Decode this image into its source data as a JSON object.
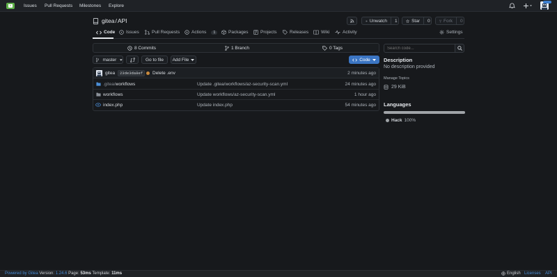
{
  "nav": {
    "items": [
      "Issues",
      "Pull Requests",
      "Milestones",
      "Explore"
    ],
    "notification_icon": "bell-icon",
    "create_icon": "plus-icon"
  },
  "repo": {
    "owner": "gitea",
    "separator": "/",
    "name": "API",
    "rss_icon": "rss-icon",
    "watch_label": "Unwatch",
    "watch_count": "1",
    "star_label": "Star",
    "star_count": "0",
    "fork_label": "Fork",
    "fork_count": "0"
  },
  "tabs": [
    {
      "label": "Code",
      "icon": "code-icon"
    },
    {
      "label": "Issues",
      "icon": "issue-icon"
    },
    {
      "label": "Pull Requests",
      "icon": "pull-request-icon"
    },
    {
      "label": "Actions",
      "icon": "play-icon",
      "count": "1"
    },
    {
      "label": "Packages",
      "icon": "package-icon"
    },
    {
      "label": "Projects",
      "icon": "project-icon"
    },
    {
      "label": "Releases",
      "icon": "tag-icon"
    },
    {
      "label": "Wiki",
      "icon": "book-icon"
    },
    {
      "label": "Activity",
      "icon": "pulse-icon"
    },
    {
      "label": "Settings",
      "icon": "gear-icon"
    }
  ],
  "stats": {
    "commits": "8 Commits",
    "branches": "1 Branch",
    "tags": "0 Tags"
  },
  "toolbar": {
    "branch": "master",
    "go_to_file": "Go to file",
    "add_file": "Add File",
    "code": "Code"
  },
  "latest_commit": {
    "author": "gitea",
    "sha": "23de3da8ef",
    "message": "Delete .env",
    "time": "2 minutes ago"
  },
  "files": [
    {
      "name_prefix": ".gitea/",
      "name": "workflows",
      "commit": "Update .gitea/workflows/az-security-scan.yml",
      "time": "24 minutes ago"
    },
    {
      "name_prefix": "",
      "name": "workflows",
      "commit": "Update workflows/az-security-scan.yml",
      "time": "1 hour ago"
    },
    {
      "name_prefix": "",
      "name": "index.php",
      "commit": "Update index.php",
      "time": "54 minutes ago"
    }
  ],
  "sidebar": {
    "search_placeholder": "Search code...",
    "description_title": "Description",
    "description": "No description provided",
    "manage_topics": "Manage Topics",
    "size": "29 KiB",
    "languages_title": "Languages",
    "language": "Hack",
    "language_percent": "100%",
    "language_color": "#a0a4a8"
  },
  "footer": {
    "powered_by": "Powered by Gitea",
    "version_label": "Version:",
    "version": "1.24.6",
    "page_label": "Page:",
    "page_time": "53ms",
    "template_label": "Template:",
    "template_time": "11ms",
    "language": "English",
    "licenses": "Licenses",
    "api": "API"
  }
}
